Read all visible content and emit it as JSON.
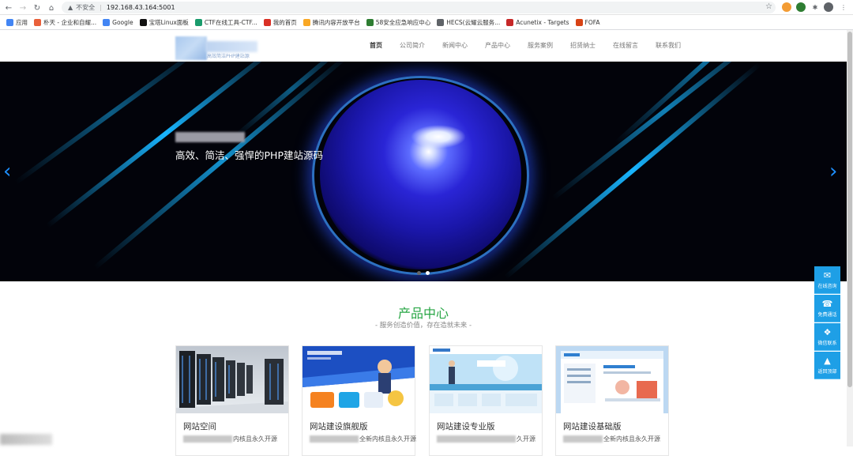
{
  "browser": {
    "url_host": "192.168.43.164:5001",
    "security_label": "不安全",
    "bookmarks": [
      "应用",
      "朴天 - 企业和自耀...",
      "Google",
      "宝塔Linux面板",
      "CTF在线工具-CTF...",
      "我的首页",
      "腾讯内容开放平台",
      "58安全应急响应中心",
      "HECS(云耀云服务...",
      "Acunetix - Targets",
      "FOFA"
    ],
    "bookmark_colors": [
      "#4285f4",
      "#e9603a",
      "#4285f4",
      "#111111",
      "#1a9b6c",
      "#d93025",
      "#f9a825",
      "#2e7d32",
      "#5f6368",
      "#c62828",
      "#d84315",
      "#3f6fb5"
    ]
  },
  "site": {
    "logo_tagline": "高效简洁PHP建站源",
    "nav": [
      "首页",
      "公司简介",
      "新闻中心",
      "产品中心",
      "服务案例",
      "招贤纳士",
      "在线留言",
      "联系我们"
    ],
    "active_nav_index": 0
  },
  "hero": {
    "title": "高效、简洁、强悍的PHP建站源码",
    "slide_count": 2,
    "active_slide": 1
  },
  "products": {
    "title": "产品中心",
    "subtitle": "- 服务创造价值，存在造就未来 -",
    "cards": [
      {
        "name": "网站空间",
        "desc_tail": "内核且永久开源"
      },
      {
        "name": "网站建设旗舰版",
        "desc_tail": "全新内核且永久开源"
      },
      {
        "name": "网站建设专业版",
        "desc_tail": "久开源"
      },
      {
        "name": "网站建设基础版",
        "desc_tail": "全新内核且永久开源"
      }
    ]
  },
  "side_tools": [
    {
      "label": "在线咨询",
      "icon": "chat-icon"
    },
    {
      "label": "免费通话",
      "icon": "phone-icon"
    },
    {
      "label": "微信联系",
      "icon": "wechat-icon"
    },
    {
      "label": "返回顶部",
      "icon": "arrow-up-icon"
    }
  ],
  "colors": {
    "accent_green": "#27a644",
    "side_blue": "#1e9fe6",
    "arrow_blue": "#1e90ff"
  }
}
